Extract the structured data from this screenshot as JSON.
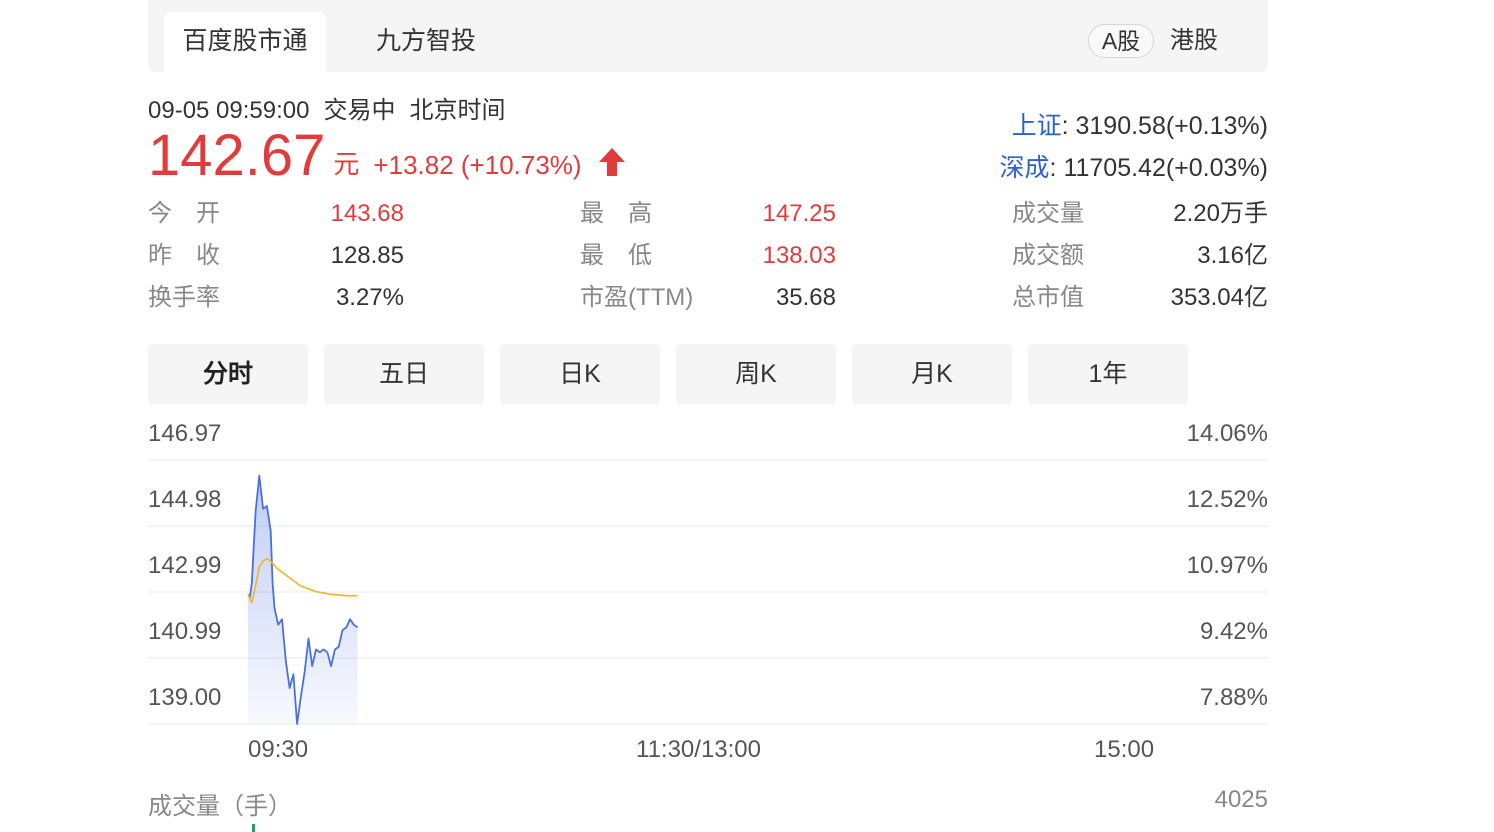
{
  "tabs": [
    {
      "label": "百度股市通",
      "active": true
    },
    {
      "label": "九方智投",
      "active": false
    }
  ],
  "market_toggle": {
    "selected": "A股",
    "other": "港股"
  },
  "quote": {
    "datetime": "09-05 09:59:00",
    "status": "交易中",
    "timezone": "北京时间",
    "price": "142.67",
    "unit": "元",
    "change": "+13.82 (+10.73%)",
    "direction": "up",
    "up_color": "#e23b3b"
  },
  "indices": [
    {
      "name": "上证",
      "value": ": 3190.58(+0.13%)"
    },
    {
      "name": "深成",
      "value": ": 11705.42(+0.03%)"
    }
  ],
  "stats": [
    {
      "label": "今　开",
      "value": "143.68",
      "red": true
    },
    {
      "label": "最　高",
      "value": "147.25",
      "red": true
    },
    {
      "label": "成交量",
      "value": "2.20万手",
      "red": false
    },
    {
      "label": "昨　收",
      "value": "128.85",
      "red": false
    },
    {
      "label": "最　低",
      "value": "138.03",
      "red": true
    },
    {
      "label": "成交额",
      "value": "3.16亿",
      "red": false
    },
    {
      "label": "换手率",
      "value": "3.27%",
      "red": false
    },
    {
      "label": "市盈(TTM)",
      "value": "35.68",
      "red": false
    },
    {
      "label": "总市值",
      "value": "353.04亿",
      "red": false
    }
  ],
  "periods": [
    {
      "label": "分时",
      "active": true
    },
    {
      "label": "五日",
      "active": false
    },
    {
      "label": "日K",
      "active": false
    },
    {
      "label": "周K",
      "active": false
    },
    {
      "label": "月K",
      "active": false
    },
    {
      "label": "1年",
      "active": false
    }
  ],
  "chart_data": {
    "type": "line",
    "y_left_ticks": [
      "146.97",
      "144.98",
      "142.99",
      "140.99",
      "139.00"
    ],
    "y_right_ticks": [
      "14.06%",
      "12.52%",
      "10.97%",
      "9.42%",
      "7.88%"
    ],
    "ylim": [
      138.2,
      147.77
    ],
    "x_ticks": [
      "09:30",
      "11:30/13:00",
      "15:00"
    ],
    "x_range_minutes": [
      0,
      240
    ],
    "grid": true,
    "series": [
      {
        "role": "price",
        "color": "#4a6fe3",
        "x": [
          0,
          0.5,
          1,
          2,
          3,
          4,
          5,
          6,
          6.5,
          7,
          8,
          9,
          10,
          11,
          12,
          13,
          14,
          15,
          16,
          17,
          18,
          19,
          20,
          21,
          22,
          23,
          24,
          25,
          26,
          27,
          28,
          29
        ],
        "values": [
          142.9,
          142.8,
          143.3,
          145.9,
          147.2,
          146.0,
          146.1,
          145.2,
          143.3,
          142.4,
          141.8,
          142.0,
          140.5,
          139.5,
          140.0,
          138.2,
          139.2,
          140.1,
          141.3,
          140.3,
          140.9,
          140.8,
          140.9,
          140.8,
          140.3,
          140.9,
          141.0,
          141.6,
          141.7,
          142.0,
          141.8,
          141.7
        ]
      },
      {
        "role": "average",
        "color": "#f0b427",
        "x": [
          0,
          1,
          2,
          3,
          4,
          5,
          6,
          8,
          10,
          12,
          14,
          16,
          18,
          20,
          22,
          24,
          26,
          28,
          29
        ],
        "values": [
          142.9,
          142.6,
          143.2,
          143.9,
          144.1,
          144.2,
          144.1,
          143.8,
          143.6,
          143.4,
          143.2,
          143.1,
          143.0,
          142.95,
          142.9,
          142.88,
          142.85,
          142.85,
          142.85
        ]
      }
    ]
  },
  "volume": {
    "label": "成交量（手）",
    "max": "4025",
    "bar_color": "#1aa860"
  }
}
